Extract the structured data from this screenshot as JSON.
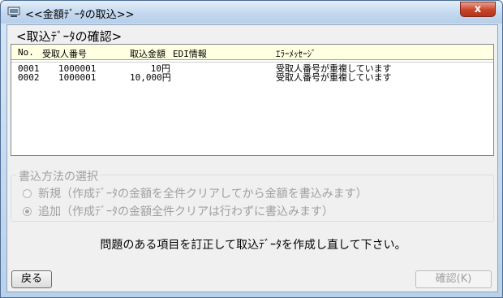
{
  "window": {
    "title": "<<金額ﾃﾞｰﾀの取込>>",
    "close_label": "x"
  },
  "section_title": "<取込ﾃﾞｰﾀの確認>",
  "table": {
    "columns": [
      "No.",
      "受取人番号",
      "取込金額",
      "EDI情報",
      "ｴﾗｰﾒｯｾｰｼﾞ"
    ],
    "rows": [
      {
        "no": "0001",
        "recipient": "1000001",
        "amount": "10円",
        "edi": "",
        "error": "受取人番号が重複しています"
      },
      {
        "no": "0002",
        "recipient": "1000001",
        "amount": "10,000円",
        "edi": "",
        "error": "受取人番号が重複しています"
      }
    ]
  },
  "group": {
    "legend": "書込方法の選択",
    "options": [
      {
        "label": "新規（作成ﾃﾞｰﾀの金額を全件クリアしてから金額を書込みます）",
        "checked": false
      },
      {
        "label": "追加（作成ﾃﾞｰﾀの金額全件クリアは行わずに書込みます）",
        "checked": true
      }
    ]
  },
  "message": "問題のある項目を訂正して取込ﾃﾞｰﾀを作成し直して下さい。",
  "buttons": {
    "back": "戻る",
    "confirm": "確認(K)"
  }
}
